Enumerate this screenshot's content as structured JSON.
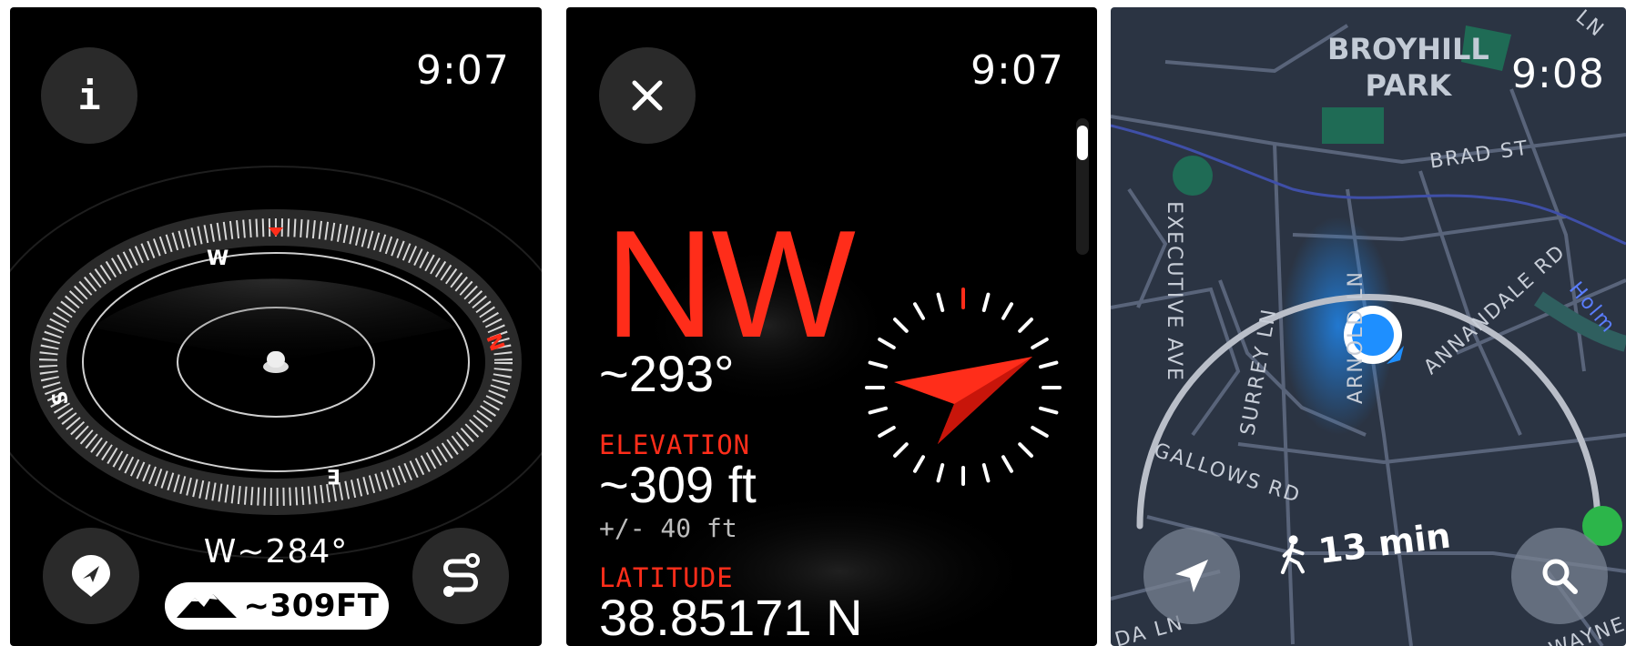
{
  "compass_screen": {
    "time": "9:07",
    "info_button_icon": "info-icon",
    "location_button_icon": "location-pin-icon",
    "backtrack_button_icon": "path-icon",
    "heading_readout": "W~284°",
    "elevation_value": "~309FT",
    "dial_letters": {
      "north": "N",
      "west": "W",
      "south": "S",
      "east": "E"
    },
    "accent_color": "#ff2d1a"
  },
  "detail_screen": {
    "time": "9:07",
    "close_icon": "close-icon",
    "direction": "NW",
    "heading_degrees": "~293°",
    "elevation": {
      "label": "ELEVATION",
      "value": "~309 ft",
      "accuracy": "+/- 40 ft"
    },
    "latitude": {
      "label": "LATITUDE",
      "value": "38.85171 N"
    }
  },
  "map_screen": {
    "time": "9:08",
    "park_name": [
      "BROYHILL",
      "PARK"
    ],
    "streets": {
      "brad": "BRAD ST",
      "executive": "EXECUTIVE AVE",
      "surrey": "SURREY LN",
      "arnold": "ARNOLD LN",
      "annandale": "ANNANDALE RD",
      "gallows": "GALLOWS RD",
      "wayne": "WAYNE",
      "da": "DA LN",
      "holmes": "Holm",
      "ln_top": "LN"
    },
    "walk_time": "13 min",
    "recenter_icon": "navigation-arrow-icon",
    "search_icon": "search-icon",
    "user_dot_color": "#1e8fff"
  }
}
